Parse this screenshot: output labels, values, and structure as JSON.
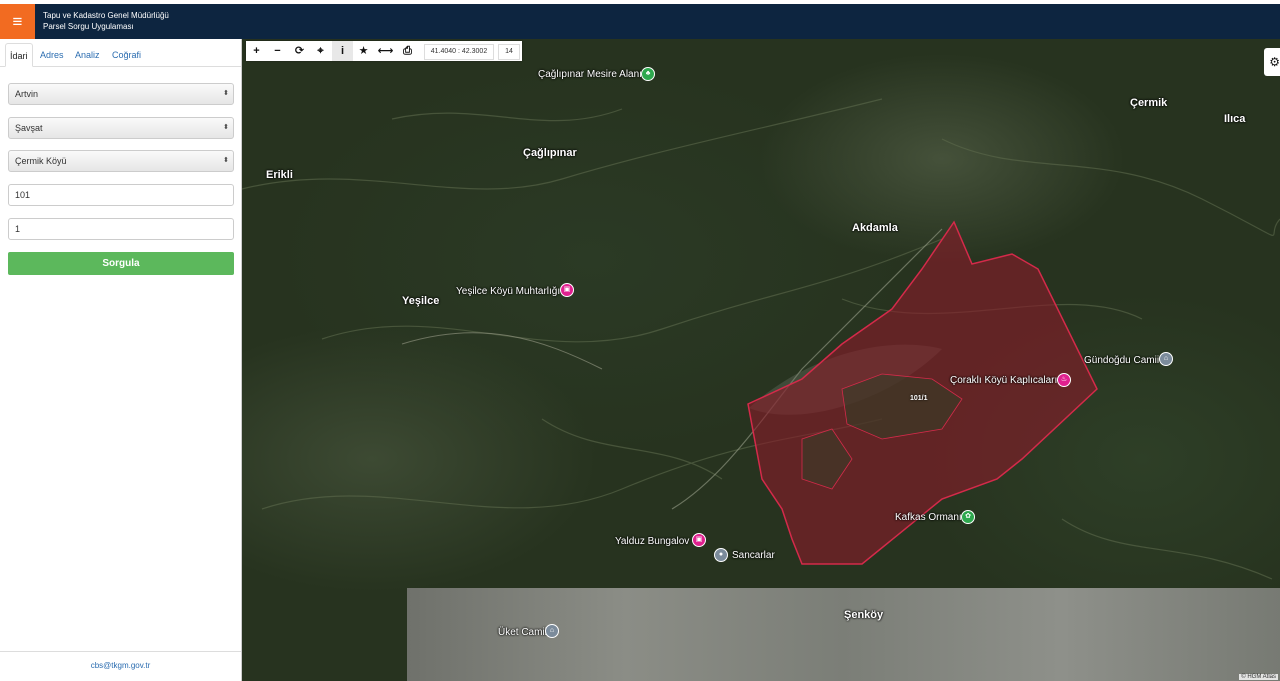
{
  "header": {
    "menu_icon": "hamburger-icon",
    "title_line1": "Tapu ve Kadastro Genel Müdürlüğü",
    "title_line2": "Parsel Sorgu Uygulaması",
    "colors": {
      "bar": "#0d2540",
      "menu": "#f26b21"
    }
  },
  "sidebar": {
    "tabs": [
      "İdari",
      "Adres",
      "Analiz",
      "Coğrafi"
    ],
    "active_tab": "İdari",
    "province": "Artvin",
    "district": "Şavşat",
    "neighborhood": "Çermik Köyü",
    "block_no": "101",
    "parcel_no": "1",
    "query_button": "Sorgula",
    "query_button_color": "#5cb85c",
    "footer_email": "cbs@tkgm.gov.tr"
  },
  "map": {
    "toolbar": {
      "buttons": [
        "plus-icon",
        "minus-icon",
        "refresh-icon",
        "locate-icon",
        "info-icon",
        "star-icon",
        "measure-icon",
        "print-icon"
      ],
      "glyphs": [
        "+",
        "−",
        "⟳",
        "⌖",
        "i",
        "★",
        "⟷",
        "⎙"
      ],
      "coordinates": "41.4040 : 42.3002",
      "zoom": "14"
    },
    "settings_icon": "gear-icon",
    "places": {
      "caglipinar_mesire": "Çağlıpınar Mesire Alanı",
      "caglipinar": "Çağlıpınar",
      "cermik": "Çermik",
      "ilica": "Ilıca",
      "erikli": "Erikli",
      "akdamla": "Akdamla",
      "yesilce_muhtarligi": "Yeşilce Köyü Muhtarlığı",
      "yesilce": "Yeşilce",
      "gundogdu_camii": "Gündoğdu Camii",
      "corakli_kaplicalari": "Çoraklı Köyü Kaplıcaları",
      "kafkas_ormani": "Kafkas Ormanı",
      "yalduz_bungalov": "Yalduz Bungalov",
      "sancarlar": "Sancarlar",
      "uket_camii": "Üket Camii",
      "senkoy": "Şenköy"
    },
    "parcel_label": "101/1",
    "parcel_color": "#8b1a2a",
    "attribution": "© HGM Atlas"
  }
}
